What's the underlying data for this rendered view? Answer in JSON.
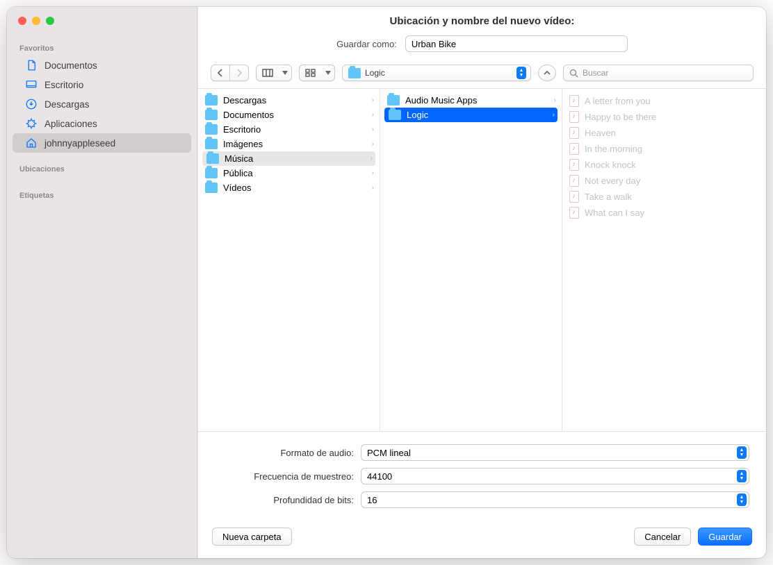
{
  "title": "Ubicación y nombre del nuevo vídeo:",
  "save": {
    "label": "Guardar como:",
    "value": "Urban Bike"
  },
  "location": {
    "name": "Logic"
  },
  "search": {
    "placeholder": "Buscar"
  },
  "sidebar": {
    "sections": [
      {
        "header": "Favoritos",
        "items": [
          {
            "name": "documentos",
            "label": "Documentos",
            "icon": "doc"
          },
          {
            "name": "escritorio",
            "label": "Escritorio",
            "icon": "desktop"
          },
          {
            "name": "descargas",
            "label": "Descargas",
            "icon": "download"
          },
          {
            "name": "aplicaciones",
            "label": "Aplicaciones",
            "icon": "apps"
          },
          {
            "name": "home",
            "label": "johnnyappleseed",
            "icon": "home",
            "selected": true
          }
        ]
      },
      {
        "header": "Ubicaciones",
        "items": []
      },
      {
        "header": "Etiquetas",
        "items": []
      }
    ]
  },
  "col1": [
    {
      "label": "Descargas"
    },
    {
      "label": "Documentos"
    },
    {
      "label": "Escritorio"
    },
    {
      "label": "Imágenes"
    },
    {
      "label": "Música",
      "selected": "grey"
    },
    {
      "label": "Pública"
    },
    {
      "label": "Vídeos"
    }
  ],
  "col2": [
    {
      "label": "Audio Music Apps"
    },
    {
      "label": "Logic",
      "selected": "blue"
    }
  ],
  "col3": [
    {
      "label": "A letter from you"
    },
    {
      "label": "Happy to be there"
    },
    {
      "label": "Heaven"
    },
    {
      "label": "In the morning"
    },
    {
      "label": "Knock knock"
    },
    {
      "label": "Not every day"
    },
    {
      "label": "Take a walk"
    },
    {
      "label": "What can I say"
    }
  ],
  "options": {
    "audioFormat": {
      "label": "Formato de audio:",
      "value": "PCM lineal"
    },
    "sampleRate": {
      "label": "Frecuencia de muestreo:",
      "value": "44100"
    },
    "bitDepth": {
      "label": "Profundidad de bits:",
      "value": "16"
    }
  },
  "buttons": {
    "newFolder": "Nueva carpeta",
    "cancel": "Cancelar",
    "save": "Guardar"
  }
}
